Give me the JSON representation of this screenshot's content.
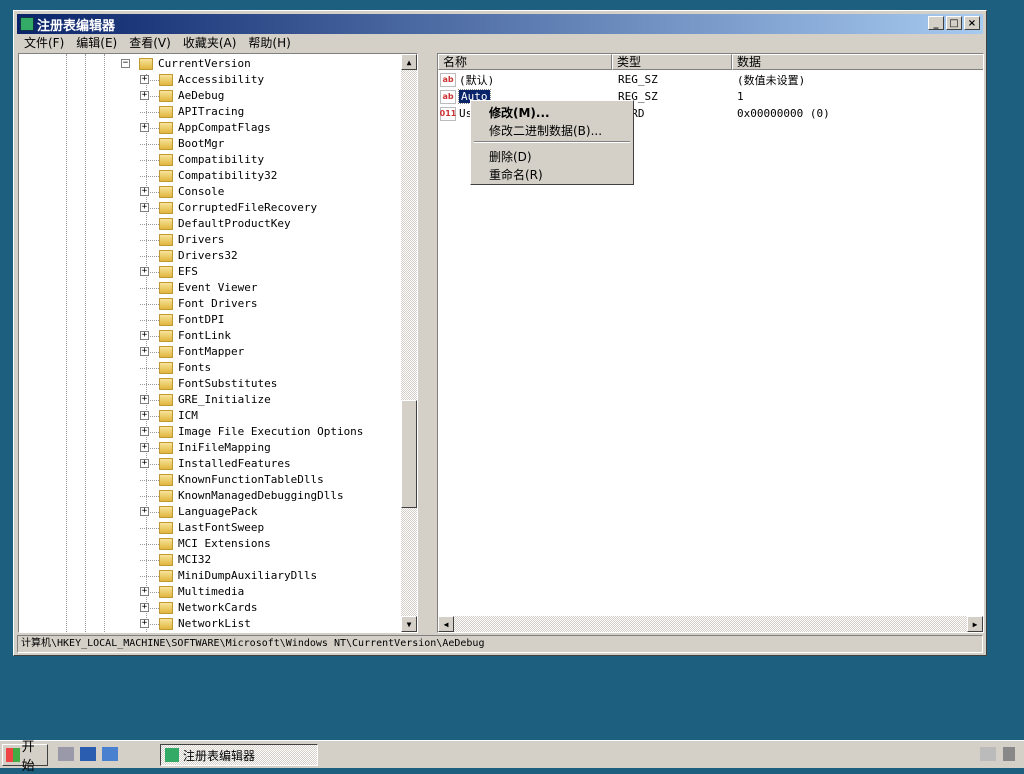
{
  "window": {
    "title": "注册表编辑器"
  },
  "menu": [
    "文件(F)",
    "编辑(E)",
    "查看(V)",
    "收藏夹(A)",
    "帮助(H)"
  ],
  "tree": {
    "parent": "CurrentVersion",
    "children": [
      {
        "name": "Accessibility",
        "expandable": true
      },
      {
        "name": "AeDebug",
        "expandable": true
      },
      {
        "name": "APITracing",
        "expandable": false
      },
      {
        "name": "AppCompatFlags",
        "expandable": true
      },
      {
        "name": "BootMgr",
        "expandable": false
      },
      {
        "name": "Compatibility",
        "expandable": false
      },
      {
        "name": "Compatibility32",
        "expandable": false
      },
      {
        "name": "Console",
        "expandable": true
      },
      {
        "name": "CorruptedFileRecovery",
        "expandable": true
      },
      {
        "name": "DefaultProductKey",
        "expandable": false
      },
      {
        "name": "Drivers",
        "expandable": false
      },
      {
        "name": "Drivers32",
        "expandable": false
      },
      {
        "name": "EFS",
        "expandable": true
      },
      {
        "name": "Event Viewer",
        "expandable": false
      },
      {
        "name": "Font Drivers",
        "expandable": false
      },
      {
        "name": "FontDPI",
        "expandable": false
      },
      {
        "name": "FontLink",
        "expandable": true
      },
      {
        "name": "FontMapper",
        "expandable": true
      },
      {
        "name": "Fonts",
        "expandable": false
      },
      {
        "name": "FontSubstitutes",
        "expandable": false
      },
      {
        "name": "GRE_Initialize",
        "expandable": true
      },
      {
        "name": "ICM",
        "expandable": true
      },
      {
        "name": "Image File Execution Options",
        "expandable": true
      },
      {
        "name": "IniFileMapping",
        "expandable": true
      },
      {
        "name": "InstalledFeatures",
        "expandable": true
      },
      {
        "name": "KnownFunctionTableDlls",
        "expandable": false
      },
      {
        "name": "KnownManagedDebuggingDlls",
        "expandable": false
      },
      {
        "name": "LanguagePack",
        "expandable": true
      },
      {
        "name": "LastFontSweep",
        "expandable": false
      },
      {
        "name": "MCI Extensions",
        "expandable": false
      },
      {
        "name": "MCI32",
        "expandable": false
      },
      {
        "name": "MiniDumpAuxiliaryDlls",
        "expandable": false
      },
      {
        "name": "Multimedia",
        "expandable": true
      },
      {
        "name": "NetworkCards",
        "expandable": true
      },
      {
        "name": "NetworkList",
        "expandable": true
      }
    ]
  },
  "list": {
    "headers": {
      "name": "名称",
      "type": "类型",
      "data": "数据"
    },
    "rows": [
      {
        "icon": "string-value-icon",
        "name": "(默认)",
        "type": "REG_SZ",
        "data": "(数值未设置)"
      },
      {
        "icon": "string-value-icon",
        "name": "Auto",
        "type": "REG_SZ",
        "data": "1",
        "selected": true
      },
      {
        "icon": "binary-value-icon",
        "name": "User",
        "type": "WORD",
        "data": "0x00000000 (0)"
      }
    ]
  },
  "context_menu": {
    "modify": "修改(M)...",
    "modify_binary": "修改二进制数据(B)...",
    "delete": "删除(D)",
    "rename": "重命名(R)"
  },
  "status": "计算机\\HKEY_LOCAL_MACHINE\\SOFTWARE\\Microsoft\\Windows NT\\CurrentVersion\\AeDebug",
  "taskbar": {
    "start": "开始",
    "task": "注册表编辑器"
  },
  "colors": {
    "titlebar": "#0a246a",
    "desktop": "#1d5f7f",
    "selection": "#0a246a"
  }
}
